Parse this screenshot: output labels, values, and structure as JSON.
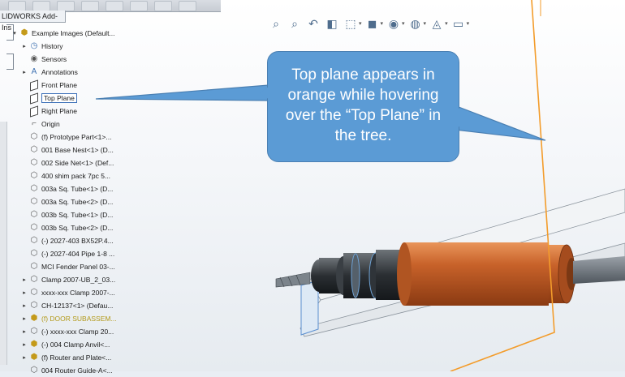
{
  "toolbar": {
    "addins_tab": "LIDWORKS Add-Ins"
  },
  "tree": {
    "root": "Example Images  (Default...",
    "items": [
      {
        "label": "History",
        "icon": "history-icon",
        "expander": true
      },
      {
        "label": "Sensors",
        "icon": "sensors-icon",
        "expander": false
      },
      {
        "label": "Annotations",
        "icon": "annotations-icon",
        "expander": true
      },
      {
        "label": "Front Plane",
        "icon": "plane-icon",
        "expander": false
      },
      {
        "label": "Top Plane",
        "icon": "plane-icon",
        "expander": false
      },
      {
        "label": "Right Plane",
        "icon": "plane-icon",
        "expander": false
      },
      {
        "label": "Origin",
        "icon": "origin-icon",
        "expander": false
      },
      {
        "label": "(f) Prototype Part<1>...",
        "icon": "part-icon",
        "expander": false
      },
      {
        "label": "001 Base Nest<1> (D...",
        "icon": "part-icon",
        "expander": false
      },
      {
        "label": "002 Side Net<1> (Def...",
        "icon": "part-icon",
        "expander": false
      },
      {
        "label": "400 shim pack 7pc 5...",
        "icon": "part-icon",
        "expander": false
      },
      {
        "label": "003a Sq. Tube<1> (D...",
        "icon": "part-icon",
        "expander": false
      },
      {
        "label": "003a Sq. Tube<2> (D...",
        "icon": "part-icon",
        "expander": false
      },
      {
        "label": "003b Sq. Tube<1> (D...",
        "icon": "part-icon",
        "expander": false
      },
      {
        "label": "003b Sq. Tube<2> (D...",
        "icon": "part-icon",
        "expander": false
      },
      {
        "label": "(-) 2027-403 BX52P.4...",
        "icon": "part-icon",
        "expander": false
      },
      {
        "label": "(-) 2027-404 Pipe 1-8 ...",
        "icon": "part-icon",
        "expander": false
      },
      {
        "label": "MCI Fender Panel 03-...",
        "icon": "part-icon",
        "expander": false
      },
      {
        "label": "Clamp 2007-UB_2_03...",
        "icon": "part-icon",
        "expander": true
      },
      {
        "label": "xxxx-xxx Clamp 2007-...",
        "icon": "part-icon",
        "expander": true
      },
      {
        "label": "CH-12137<1> (Defau...",
        "icon": "part-icon",
        "expander": true
      },
      {
        "label": "(f) DOOR SUBASSEM...",
        "icon": "assembly-icon",
        "expander": true
      },
      {
        "label": "(-) xxxx-xxx Clamp 20...",
        "icon": "part-icon",
        "expander": true
      },
      {
        "label": "(-) 004 Clamp Anvil<...",
        "icon": "assembly-icon",
        "expander": true
      },
      {
        "label": "(f) Router and Plate<...",
        "icon": "assembly-icon",
        "expander": true
      },
      {
        "label": "004 Router Guide-A<...",
        "icon": "part-icon",
        "expander": false
      }
    ]
  },
  "hud": [
    "zoom-fit-icon",
    "zoom-area-icon",
    "previous-view-icon",
    "section-view-icon",
    "view-orientation-icon",
    "display-style-icon",
    "hide-show-icon",
    "edit-appearance-icon",
    "apply-scene-icon",
    "view-settings-icon"
  ],
  "callout": {
    "text": "Top plane appears in orange while hovering over the “Top Plane” in the tree."
  },
  "colors": {
    "callout_fill": "#5b9bd5",
    "plane_highlight": "#f39c2b",
    "motor_orange": "#c8622a"
  }
}
